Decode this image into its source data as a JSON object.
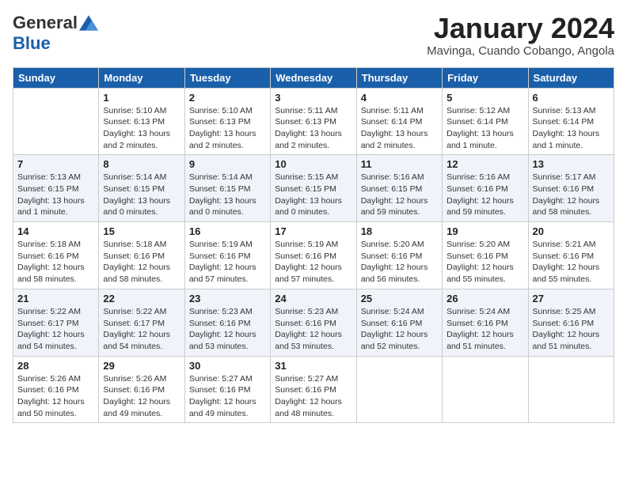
{
  "logo": {
    "general": "General",
    "blue": "Blue"
  },
  "title": "January 2024",
  "subtitle": "Mavinga, Cuando Cobango, Angola",
  "days_of_week": [
    "Sunday",
    "Monday",
    "Tuesday",
    "Wednesday",
    "Thursday",
    "Friday",
    "Saturday"
  ],
  "weeks": [
    [
      {
        "day": "",
        "info": ""
      },
      {
        "day": "1",
        "info": "Sunrise: 5:10 AM\nSunset: 6:13 PM\nDaylight: 13 hours\nand 2 minutes."
      },
      {
        "day": "2",
        "info": "Sunrise: 5:10 AM\nSunset: 6:13 PM\nDaylight: 13 hours\nand 2 minutes."
      },
      {
        "day": "3",
        "info": "Sunrise: 5:11 AM\nSunset: 6:13 PM\nDaylight: 13 hours\nand 2 minutes."
      },
      {
        "day": "4",
        "info": "Sunrise: 5:11 AM\nSunset: 6:14 PM\nDaylight: 13 hours\nand 2 minutes."
      },
      {
        "day": "5",
        "info": "Sunrise: 5:12 AM\nSunset: 6:14 PM\nDaylight: 13 hours\nand 1 minute."
      },
      {
        "day": "6",
        "info": "Sunrise: 5:13 AM\nSunset: 6:14 PM\nDaylight: 13 hours\nand 1 minute."
      }
    ],
    [
      {
        "day": "7",
        "info": "Sunrise: 5:13 AM\nSunset: 6:15 PM\nDaylight: 13 hours\nand 1 minute."
      },
      {
        "day": "8",
        "info": "Sunrise: 5:14 AM\nSunset: 6:15 PM\nDaylight: 13 hours\nand 0 minutes."
      },
      {
        "day": "9",
        "info": "Sunrise: 5:14 AM\nSunset: 6:15 PM\nDaylight: 13 hours\nand 0 minutes."
      },
      {
        "day": "10",
        "info": "Sunrise: 5:15 AM\nSunset: 6:15 PM\nDaylight: 13 hours\nand 0 minutes."
      },
      {
        "day": "11",
        "info": "Sunrise: 5:16 AM\nSunset: 6:15 PM\nDaylight: 12 hours\nand 59 minutes."
      },
      {
        "day": "12",
        "info": "Sunrise: 5:16 AM\nSunset: 6:16 PM\nDaylight: 12 hours\nand 59 minutes."
      },
      {
        "day": "13",
        "info": "Sunrise: 5:17 AM\nSunset: 6:16 PM\nDaylight: 12 hours\nand 58 minutes."
      }
    ],
    [
      {
        "day": "14",
        "info": "Sunrise: 5:18 AM\nSunset: 6:16 PM\nDaylight: 12 hours\nand 58 minutes."
      },
      {
        "day": "15",
        "info": "Sunrise: 5:18 AM\nSunset: 6:16 PM\nDaylight: 12 hours\nand 58 minutes."
      },
      {
        "day": "16",
        "info": "Sunrise: 5:19 AM\nSunset: 6:16 PM\nDaylight: 12 hours\nand 57 minutes."
      },
      {
        "day": "17",
        "info": "Sunrise: 5:19 AM\nSunset: 6:16 PM\nDaylight: 12 hours\nand 57 minutes."
      },
      {
        "day": "18",
        "info": "Sunrise: 5:20 AM\nSunset: 6:16 PM\nDaylight: 12 hours\nand 56 minutes."
      },
      {
        "day": "19",
        "info": "Sunrise: 5:20 AM\nSunset: 6:16 PM\nDaylight: 12 hours\nand 55 minutes."
      },
      {
        "day": "20",
        "info": "Sunrise: 5:21 AM\nSunset: 6:16 PM\nDaylight: 12 hours\nand 55 minutes."
      }
    ],
    [
      {
        "day": "21",
        "info": "Sunrise: 5:22 AM\nSunset: 6:17 PM\nDaylight: 12 hours\nand 54 minutes."
      },
      {
        "day": "22",
        "info": "Sunrise: 5:22 AM\nSunset: 6:17 PM\nDaylight: 12 hours\nand 54 minutes."
      },
      {
        "day": "23",
        "info": "Sunrise: 5:23 AM\nSunset: 6:16 PM\nDaylight: 12 hours\nand 53 minutes."
      },
      {
        "day": "24",
        "info": "Sunrise: 5:23 AM\nSunset: 6:16 PM\nDaylight: 12 hours\nand 53 minutes."
      },
      {
        "day": "25",
        "info": "Sunrise: 5:24 AM\nSunset: 6:16 PM\nDaylight: 12 hours\nand 52 minutes."
      },
      {
        "day": "26",
        "info": "Sunrise: 5:24 AM\nSunset: 6:16 PM\nDaylight: 12 hours\nand 51 minutes."
      },
      {
        "day": "27",
        "info": "Sunrise: 5:25 AM\nSunset: 6:16 PM\nDaylight: 12 hours\nand 51 minutes."
      }
    ],
    [
      {
        "day": "28",
        "info": "Sunrise: 5:26 AM\nSunset: 6:16 PM\nDaylight: 12 hours\nand 50 minutes."
      },
      {
        "day": "29",
        "info": "Sunrise: 5:26 AM\nSunset: 6:16 PM\nDaylight: 12 hours\nand 49 minutes."
      },
      {
        "day": "30",
        "info": "Sunrise: 5:27 AM\nSunset: 6:16 PM\nDaylight: 12 hours\nand 49 minutes."
      },
      {
        "day": "31",
        "info": "Sunrise: 5:27 AM\nSunset: 6:16 PM\nDaylight: 12 hours\nand 48 minutes."
      },
      {
        "day": "",
        "info": ""
      },
      {
        "day": "",
        "info": ""
      },
      {
        "day": "",
        "info": ""
      }
    ]
  ]
}
